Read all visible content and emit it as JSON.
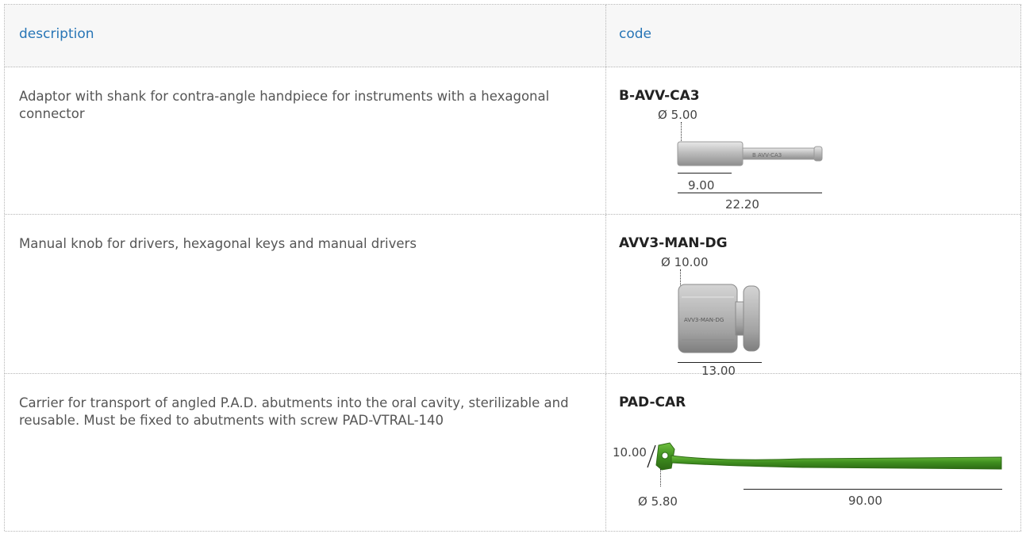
{
  "header": {
    "description": "description",
    "code": "code"
  },
  "rows": [
    {
      "description": "Adaptor with shank for contra-angle handpiece for instruments with a hexagonal connector",
      "code": "B-AVV-CA3",
      "diameter": "Ø 5.00",
      "length_1": "9.00",
      "length_2": "22.20",
      "engraving": "B AVV-CA3"
    },
    {
      "description": "Manual knob for drivers, hexagonal keys and manual drivers",
      "code": "AVV3-MAN-DG",
      "diameter": "Ø 10.00",
      "length_1": "13.00",
      "engraving": "AVV3-MAN-DG"
    },
    {
      "description": "Carrier for transport of angled P.A.D. abutments into the oral cavity, sterilizable and reusable. Must be fixed to abutments with screw PAD-VTRAL-140",
      "code": "PAD-CAR",
      "angle": "10.00",
      "diameter": "Ø 5.80",
      "length_1": "90.00"
    }
  ],
  "colors": {
    "header_text": "#2775b6",
    "carrier_green": "#3f8f1f",
    "metal": "#b9b9b9"
  }
}
